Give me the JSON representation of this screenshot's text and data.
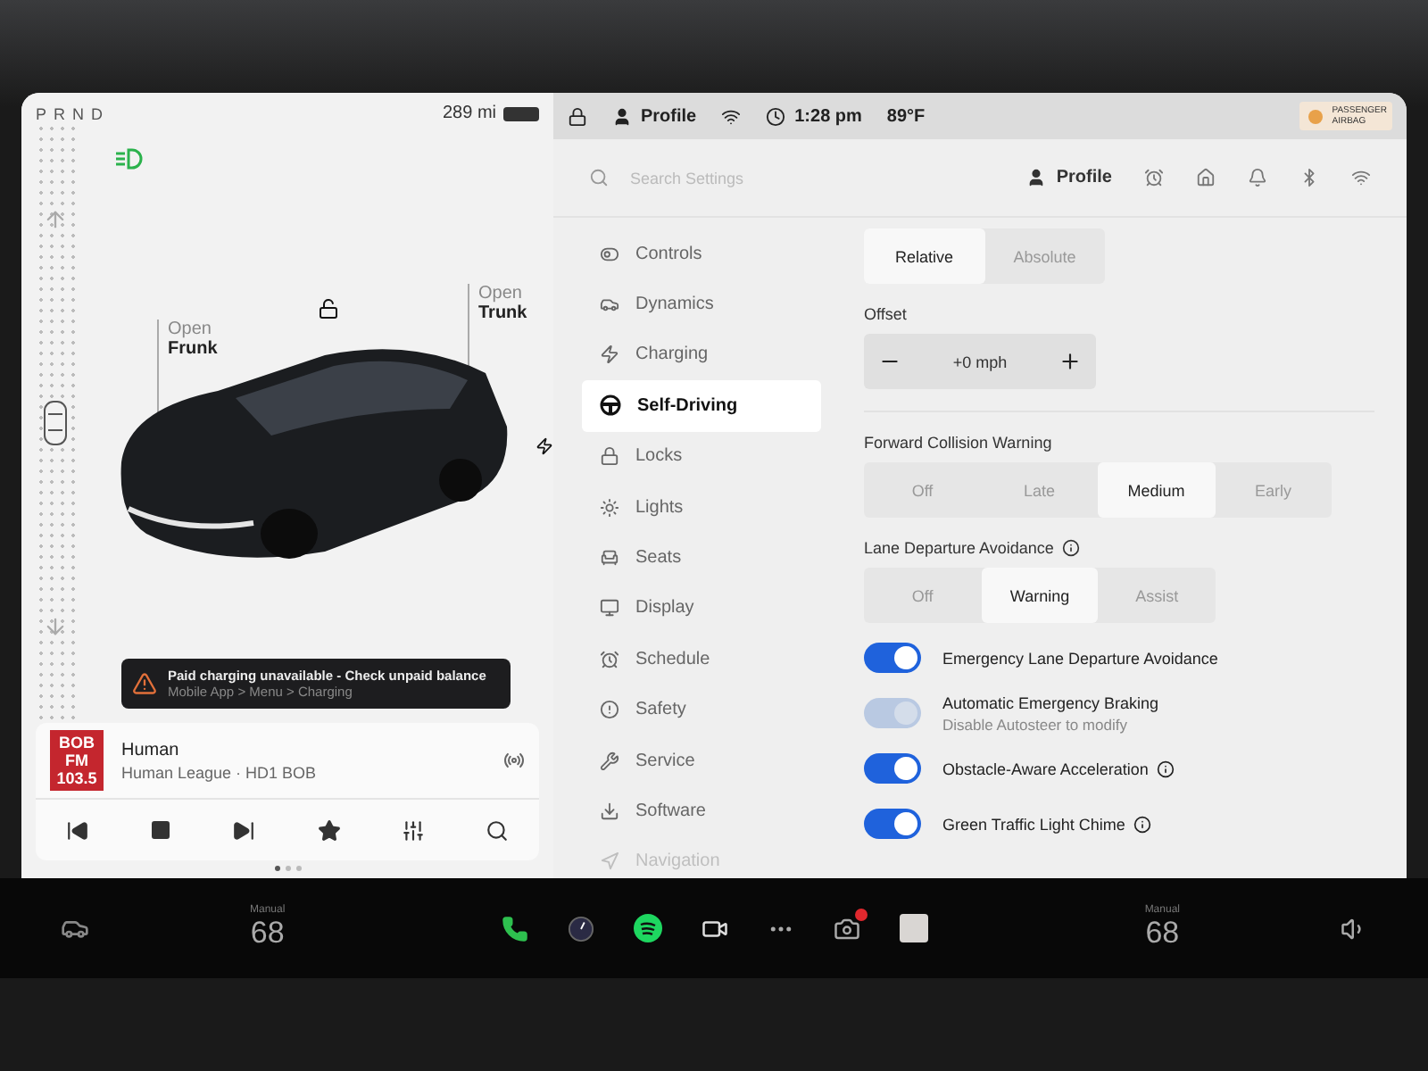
{
  "drive": {
    "gears": [
      "P",
      "R",
      "N",
      "D"
    ],
    "range": "289 mi"
  },
  "car_panel": {
    "frunk": {
      "action": "Open",
      "name": "Frunk"
    },
    "trunk": {
      "action": "Open",
      "name": "Trunk"
    }
  },
  "alert": {
    "title": "Paid charging unavailable - Check unpaid balance",
    "path": "Mobile App > Menu > Charging"
  },
  "media": {
    "logo": [
      "BOB",
      "FM",
      "103.5"
    ],
    "title": "Human",
    "subtitle": "Human League · HD1 BOB"
  },
  "status_bar": {
    "profile": "Profile",
    "time": "1:28 pm",
    "temperature": "89°F",
    "airbag": [
      "PASSENGER",
      "AIRBAG"
    ]
  },
  "settings": {
    "search_placeholder": "Search Settings",
    "profile": "Profile",
    "menu": [
      {
        "kind": "controls",
        "label": "Controls",
        "selected": false
      },
      {
        "kind": "dynamics",
        "label": "Dynamics",
        "selected": false
      },
      {
        "kind": "charging",
        "label": "Charging",
        "selected": false
      },
      {
        "kind": "wheel",
        "label": "Self-Driving",
        "selected": true
      },
      {
        "kind": "locks",
        "label": "Locks",
        "selected": false
      },
      {
        "kind": "lights",
        "label": "Lights",
        "selected": false
      },
      {
        "kind": "seats",
        "label": "Seats",
        "selected": false
      },
      {
        "kind": "display",
        "label": "Display",
        "selected": false
      },
      {
        "kind": "schedule",
        "label": "Schedule",
        "selected": false
      },
      {
        "kind": "safety",
        "label": "Safety",
        "selected": false
      },
      {
        "kind": "service",
        "label": "Service",
        "selected": false
      },
      {
        "kind": "software",
        "label": "Software",
        "selected": false
      },
      {
        "kind": "navigation",
        "label": "Navigation",
        "selected": false
      }
    ],
    "speed_mode": [
      {
        "label": "Relative",
        "selected": true
      },
      {
        "label": "Absolute",
        "selected": false
      }
    ],
    "offset": {
      "label": "Offset",
      "value": "+0 mph"
    },
    "forward_collision": {
      "label": "Forward Collision Warning",
      "options": [
        {
          "label": "Off",
          "selected": false
        },
        {
          "label": "Late",
          "selected": false
        },
        {
          "label": "Medium",
          "selected": true
        },
        {
          "label": "Early",
          "selected": false
        }
      ]
    },
    "lane_departure": {
      "label": "Lane Departure Avoidance",
      "info": true,
      "options": [
        {
          "label": "Off",
          "selected": false
        },
        {
          "label": "Warning",
          "selected": true
        },
        {
          "label": "Assist",
          "selected": false
        }
      ]
    },
    "toggles": [
      {
        "label": "Emergency Lane Departure Avoidance",
        "on": true,
        "disabled": false,
        "info": false
      },
      {
        "label": "Automatic Emergency Braking",
        "sublabel": "Disable Autosteer to modify",
        "on": true,
        "disabled": true,
        "info": false
      },
      {
        "label": "Obstacle-Aware Acceleration",
        "on": true,
        "disabled": false,
        "info": true
      },
      {
        "label": "Green Traffic Light Chime",
        "on": true,
        "disabled": false,
        "info": true
      }
    ]
  },
  "taskbar": {
    "left_climate": {
      "mode": "Manual",
      "value": "68"
    },
    "right_climate": {
      "mode": "Manual",
      "value": "68"
    }
  }
}
